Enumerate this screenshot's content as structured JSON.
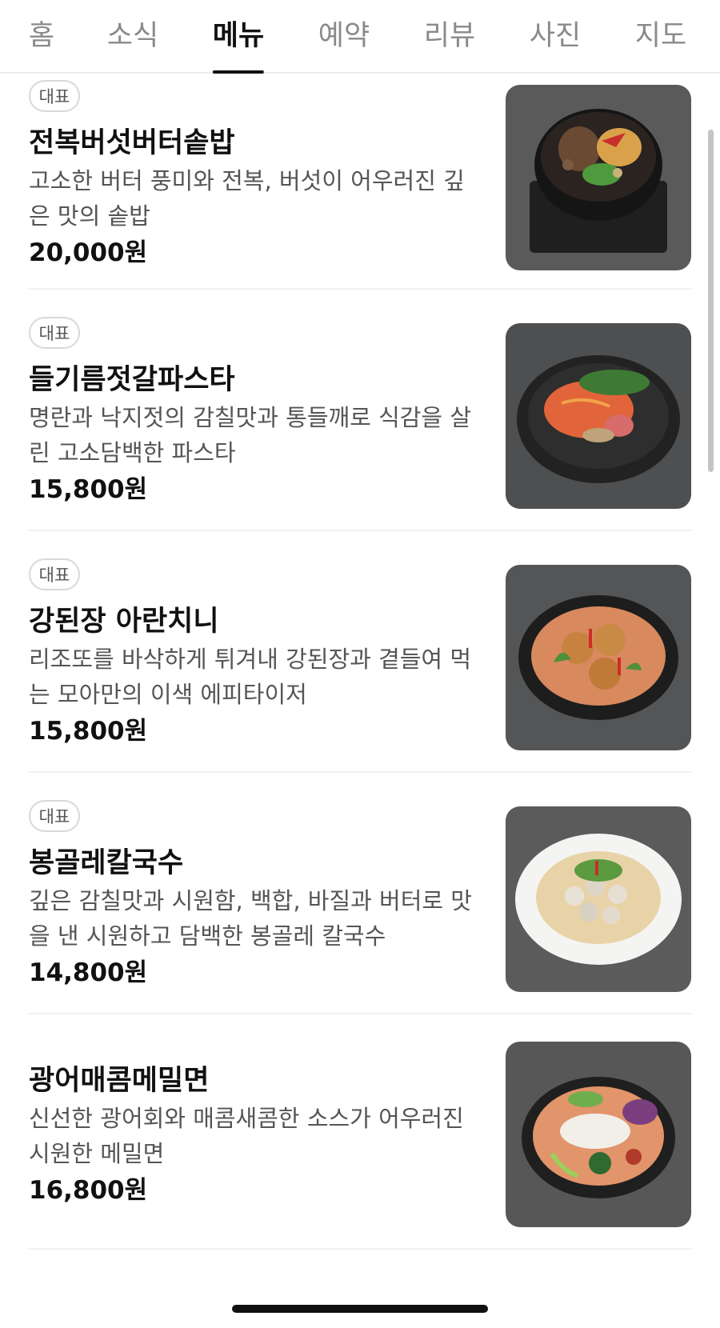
{
  "tabs": [
    {
      "label": "홈",
      "active": false
    },
    {
      "label": "소식",
      "active": false
    },
    {
      "label": "메뉴",
      "active": true
    },
    {
      "label": "예약",
      "active": false
    },
    {
      "label": "리뷰",
      "active": false
    },
    {
      "label": "사진",
      "active": false
    },
    {
      "label": "지도",
      "active": false
    }
  ],
  "menu": [
    {
      "badge": "대표",
      "name": "전복버섯버터솥밥",
      "desc": "고소한 버터 풍미와 전복, 버섯이 어우러진 깊은 맛의 솥밥",
      "price": "20,000원",
      "image": "abalone-mushroom-butter-sotbap-photo"
    },
    {
      "badge": "대표",
      "name": "들기름젓갈파스타",
      "desc": "명란과 낙지젓의 감칠맛과 통들깨로 식감을 살린 고소담백한 파스타",
      "price": "15,800원",
      "image": "perilla-oil-jeotgal-pasta-photo"
    },
    {
      "badge": "대표",
      "name": "강된장 아란치니",
      "desc": "리조또를 바삭하게 튀겨내 강된장과 곁들여 먹는 모아만의 이색 에피타이저",
      "price": "15,800원",
      "image": "gangdoenjang-arancini-photo"
    },
    {
      "badge": "대표",
      "name": "봉골레칼국수",
      "desc": "깊은 감칠맛과 시원함, 백합, 바질과 버터로 맛을 낸 시원하고 담백한 봉골레 칼국수",
      "price": "14,800원",
      "image": "vongole-kalguksu-photo"
    },
    {
      "badge": "",
      "name": "광어매콤메밀면",
      "desc": "신선한 광어회와 매콤새콤한 소스가 어우러진 시원한 메밀면",
      "price": "16,800원",
      "image": "spicy-flatfish-buckwheat-noodles-photo"
    }
  ]
}
